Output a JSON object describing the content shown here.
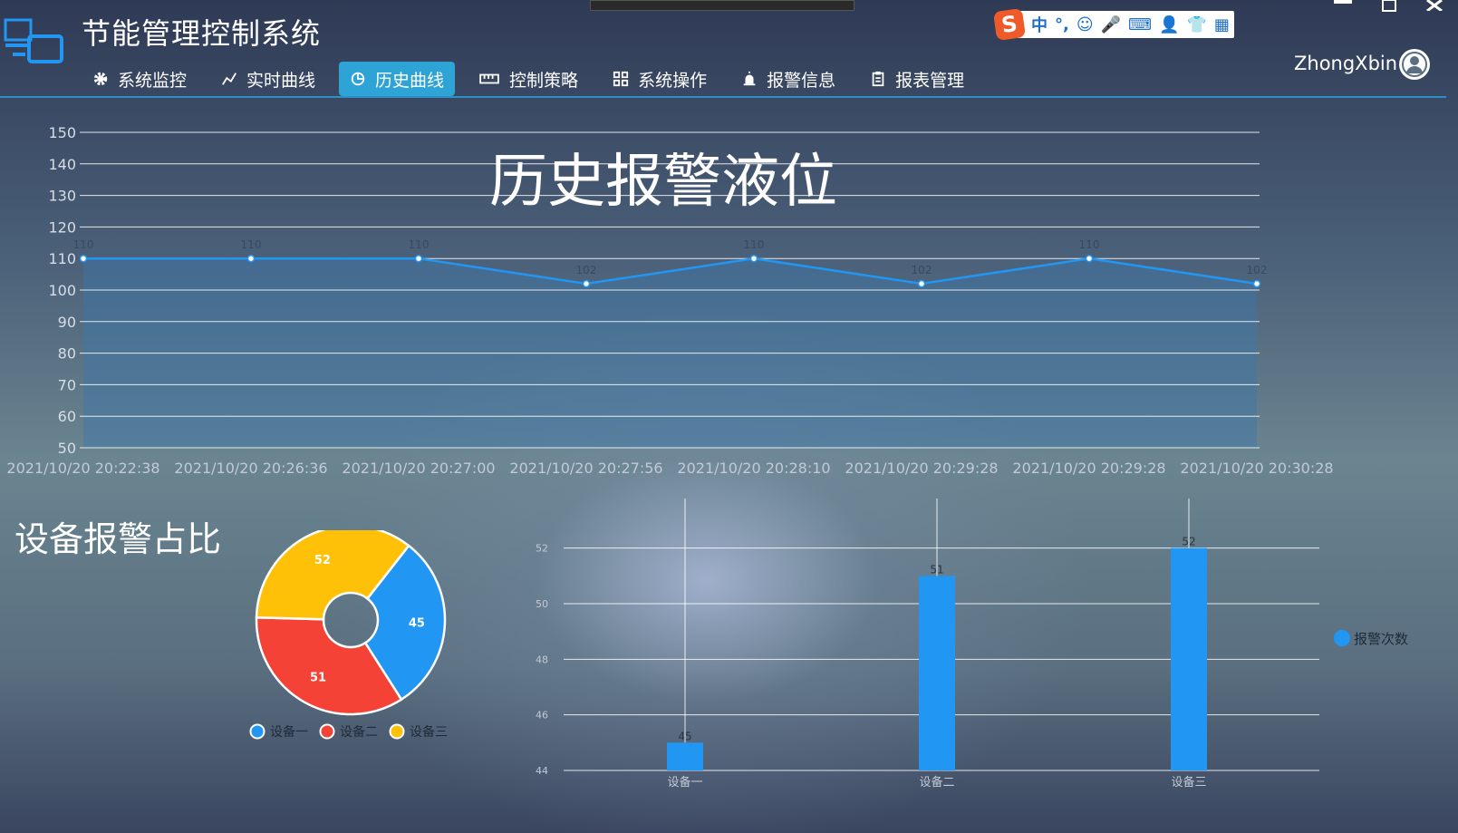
{
  "app": {
    "title": "节能管理控制系统",
    "user": "ZhongXbin"
  },
  "nav": {
    "items": [
      {
        "label": "系统监控",
        "icon": "gear-icon",
        "active": false
      },
      {
        "label": "实时曲线",
        "icon": "line-chart-icon",
        "active": false
      },
      {
        "label": "历史曲线",
        "icon": "pie-chart-icon",
        "active": true
      },
      {
        "label": "控制策略",
        "icon": "ruler-icon",
        "active": false
      },
      {
        "label": "系统操作",
        "icon": "grid-icon",
        "active": false
      },
      {
        "label": "报警信息",
        "icon": "alarm-icon",
        "active": false
      },
      {
        "label": "报表管理",
        "icon": "clipboard-icon",
        "active": false
      }
    ]
  },
  "ime": {
    "logo": "S",
    "items": [
      "中",
      "°,",
      "☺",
      "🎤",
      "⌨",
      "👤",
      "👕",
      "▦"
    ]
  },
  "history_chart": {
    "title": "历史报警液位"
  },
  "pie_section": {
    "title": "设备报警占比"
  },
  "colors": {
    "accent": "#2ea3d6",
    "series_blue": "#2196f3",
    "series_red": "#f44336",
    "series_yellow": "#ffc107"
  },
  "chart_data": [
    {
      "type": "area",
      "title": "历史报警液位",
      "x": [
        "2021/10/20 20:22:38",
        "2021/10/20 20:26:36",
        "2021/10/20 20:27:00",
        "2021/10/20 20:27:56",
        "2021/10/20 20:28:10",
        "2021/10/20 20:29:28",
        "2021/10/20 20:29:28",
        "2021/10/20 20:30:28"
      ],
      "values": [
        110,
        110,
        110,
        102,
        110,
        102,
        110,
        102
      ],
      "ylim": [
        50,
        150
      ],
      "yticks": [
        50,
        60,
        70,
        80,
        90,
        100,
        110,
        120,
        130,
        140,
        150
      ],
      "grid": true
    },
    {
      "type": "pie",
      "title": "设备报警占比",
      "categories": [
        "设备一",
        "设备二",
        "设备三"
      ],
      "values": [
        45,
        51,
        52
      ],
      "colors": [
        "#2196f3",
        "#f44336",
        "#ffc107"
      ],
      "legend": "bottom"
    },
    {
      "type": "bar",
      "categories": [
        "设备一",
        "设备二",
        "设备三"
      ],
      "series": [
        {
          "name": "报警次数",
          "values": [
            45,
            51,
            52
          ]
        }
      ],
      "ylim": [
        44,
        53
      ],
      "yticks": [
        44,
        46,
        48,
        50,
        52
      ],
      "legend": "right",
      "grid": true
    }
  ]
}
